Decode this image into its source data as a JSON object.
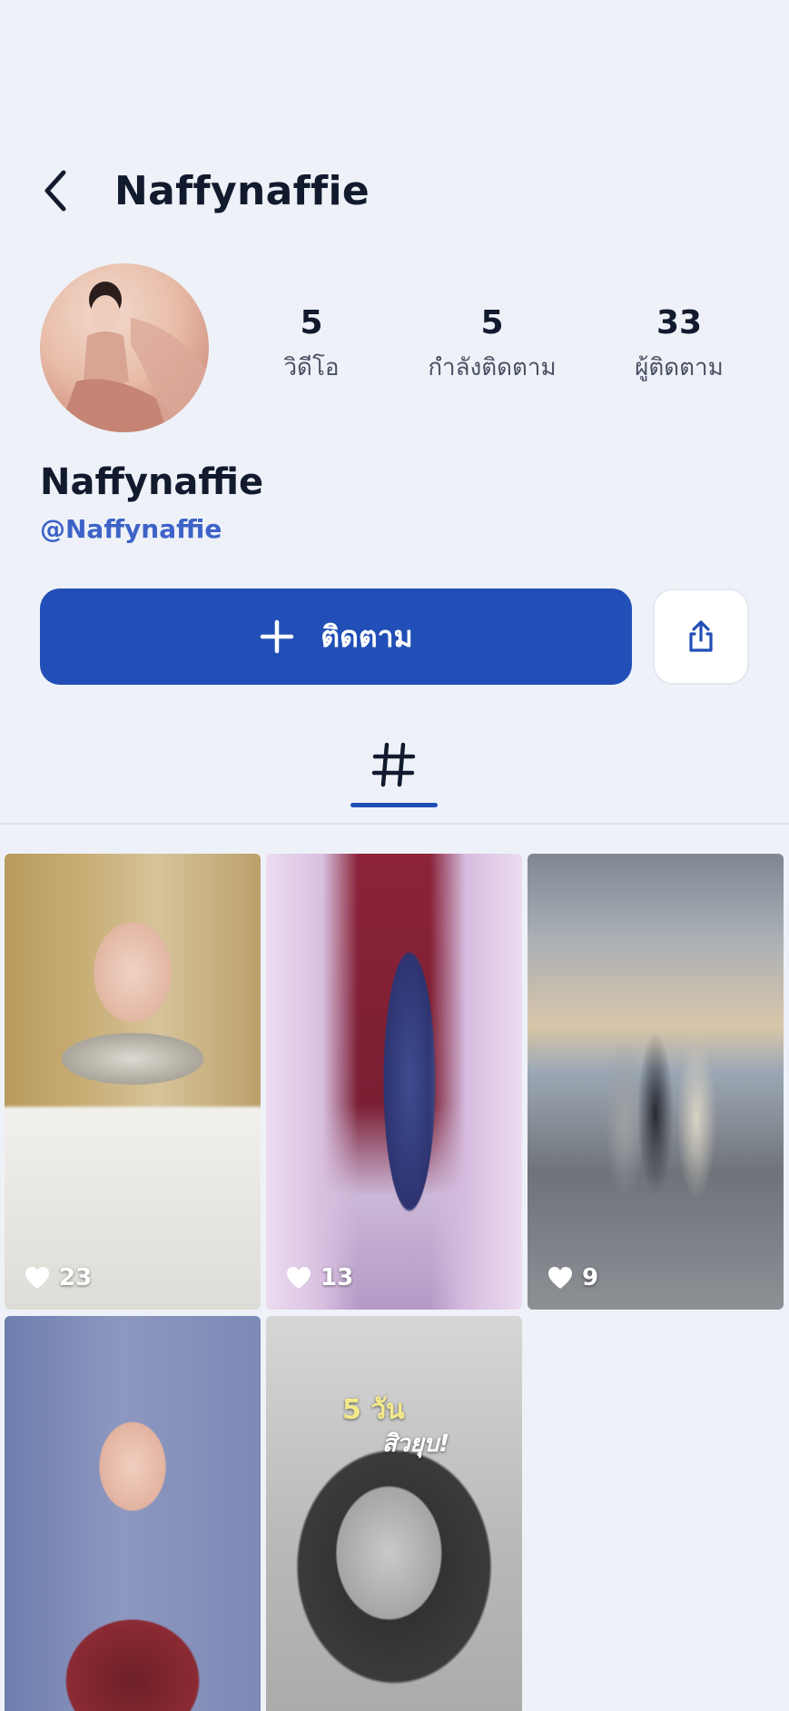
{
  "header": {
    "title": "Naffynaffie"
  },
  "profile": {
    "display_name": "Naffynaffie",
    "handle": "@Naffynaffie",
    "stats": [
      {
        "value": "5",
        "label": "วิดีโอ"
      },
      {
        "value": "5",
        "label": "กำลังติดตาม"
      },
      {
        "value": "33",
        "label": "ผู้ติดตาม"
      }
    ]
  },
  "actions": {
    "follow_label": "ติดตาม"
  },
  "colors": {
    "accent": "#224fb7",
    "handle": "#3e63c8",
    "background": "#eef2f8"
  },
  "tabs": [
    {
      "icon": "hashtag-icon",
      "active": true
    }
  ],
  "videos": [
    {
      "likes": "23"
    },
    {
      "likes": "13"
    },
    {
      "likes": "9"
    },
    {
      "likes": ""
    },
    {
      "likes": "",
      "caption_line1": "5 วัน",
      "caption_line2": "สิวยุบ!"
    }
  ]
}
